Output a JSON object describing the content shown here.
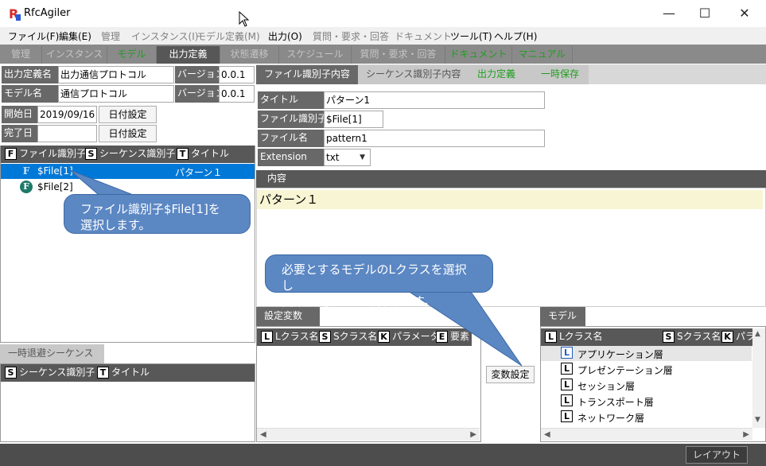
{
  "app": {
    "title": "RfcAgiler",
    "logo_letter": "R"
  },
  "window_controls": {
    "minimize": "—",
    "maximize": "☐",
    "close": "✕"
  },
  "menu": [
    {
      "label": "ファイル(F)",
      "enabled": true
    },
    {
      "label": "編集(E)",
      "enabled": true
    },
    {
      "label": "管理",
      "enabled": false
    },
    {
      "label": "インスタンス(I)",
      "enabled": false
    },
    {
      "label": "モデル定義(M)",
      "enabled": false
    },
    {
      "label": "出力(O)",
      "enabled": true
    },
    {
      "label": "質問・要求・回答",
      "enabled": false
    },
    {
      "label": "ドキュメント",
      "enabled": false
    },
    {
      "label": "ツール(T)",
      "enabled": true
    },
    {
      "label": "ヘルプ(H)",
      "enabled": true
    }
  ],
  "main_tabs": [
    {
      "label": "管理",
      "state": "inactive"
    },
    {
      "label": "インスタンス",
      "state": "inactive"
    },
    {
      "label": "モデル",
      "state": "green"
    },
    {
      "label": "出力定義",
      "state": "active"
    },
    {
      "label": "状態遷移",
      "state": "inactive"
    },
    {
      "label": "スケジュール",
      "state": "inactive"
    },
    {
      "label": "質問・要求・回答",
      "state": "inactive"
    },
    {
      "label": "ドキュメント",
      "state": "green"
    },
    {
      "label": "マニュアル",
      "state": "green"
    }
  ],
  "left_form": {
    "output_def_label": "出力定義名",
    "output_def_value": "出力通信プロトコル",
    "version_label": "バージョン",
    "version_value": "0.0.1",
    "model_label": "モデル名",
    "model_value": "通信プロトコル",
    "model_version_label": "バージョン",
    "model_version_value": "0.0.1",
    "start_label": "開始日",
    "start_value": "2019/09/16",
    "end_label": "完了日",
    "end_value": "",
    "date_button": "日付設定",
    "date_button2": "日付設定"
  },
  "file_list": {
    "headers": [
      {
        "badge": "F",
        "label": "ファイル識別子"
      },
      {
        "badge": "S",
        "label": "シーケンス識別子"
      },
      {
        "badge": "T",
        "label": "タイトル"
      }
    ],
    "rows": [
      {
        "icon": "F",
        "id": "$File[1]",
        "seq": "",
        "title": "パターン１",
        "selected": true
      },
      {
        "icon": "F",
        "id": "$File[2]",
        "seq": "",
        "title": "",
        "selected": false
      }
    ]
  },
  "temp_sequence": {
    "tab_label": "一時退避シーケンス",
    "headers": [
      {
        "badge": "S",
        "label": "シーケンス識別子"
      },
      {
        "badge": "T",
        "label": "タイトル"
      }
    ]
  },
  "right_tabs": [
    {
      "label": "ファイル識別子内容",
      "state": "active"
    },
    {
      "label": "シーケンス識別子内容",
      "state": "inactive"
    },
    {
      "label": "出力定義",
      "state": "green"
    },
    {
      "label": "一時保存",
      "state": "green"
    }
  ],
  "file_form": {
    "title_label": "タイトル",
    "title_value": "パターン1",
    "fileid_label": "ファイル識別子",
    "fileid_value": "$File[1]",
    "filename_label": "ファイル名",
    "filename_value": "pattern1",
    "ext_label": "Extension",
    "ext_value": "txt"
  },
  "content": {
    "header": "内容",
    "text": "パターン１"
  },
  "settings_vars": {
    "tab_label": "設定変数",
    "headers": [
      {
        "badge": "L",
        "label": "Lクラス名"
      },
      {
        "badge": "S",
        "label": "Sクラス名"
      },
      {
        "badge": "K",
        "label": "パラメータ"
      },
      {
        "badge": "E",
        "label": "要素"
      }
    ]
  },
  "var_set_button": "変数設定",
  "model_panel": {
    "tab_label": "モデル",
    "headers": [
      {
        "badge": "L",
        "label": "Lクラス名"
      },
      {
        "badge": "S",
        "label": "Sクラス名"
      },
      {
        "badge": "K",
        "label": "パラ"
      }
    ],
    "rows": [
      {
        "badge": "L",
        "label": "アプリケーション層",
        "selected": true
      },
      {
        "badge": "L",
        "label": "プレゼンテーション層",
        "selected": false
      },
      {
        "badge": "L",
        "label": "セッション層",
        "selected": false
      },
      {
        "badge": "L",
        "label": "トランスポート層",
        "selected": false
      },
      {
        "badge": "L",
        "label": "ネットワーク層",
        "selected": false
      }
    ]
  },
  "callouts": {
    "select_file": "ファイル識別子$File[1]を\n選択します。",
    "select_class": "必要とするモデルのLクラスを選択し\n変数設定ボタンを押します。"
  },
  "status": {
    "layout_button": "レイアウト"
  },
  "colors": {
    "selected_row": "#0078d7",
    "callout": "#5b87c3",
    "content_bg": "#f7f5d3"
  }
}
